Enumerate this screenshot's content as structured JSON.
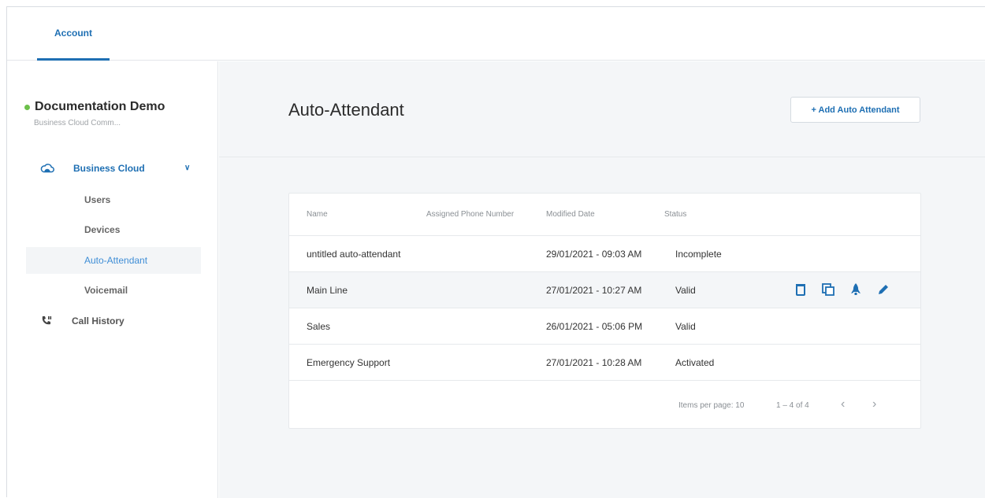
{
  "top_tabs": {
    "account": "Account"
  },
  "sidebar": {
    "account_name": "Documentation Demo",
    "account_sub": "Business Cloud Comm...",
    "group_label": "Business Cloud",
    "items": [
      {
        "label": "Users"
      },
      {
        "label": "Devices"
      },
      {
        "label": "Auto-Attendant"
      },
      {
        "label": "Voicemail"
      }
    ],
    "call_history": "Call History"
  },
  "main": {
    "title": "Auto-Attendant",
    "add_button": "+ Add Auto Attendant"
  },
  "table": {
    "columns": [
      "Name",
      "Assigned Phone Number",
      "Modified Date",
      "Status"
    ],
    "rows": [
      {
        "name": "untitled auto-attendant",
        "phone": "",
        "modified": "29/01/2021 - 09:03 AM",
        "status": "Incomplete"
      },
      {
        "name": "Main Line",
        "phone": "",
        "modified": "27/01/2021 - 10:27 AM",
        "status": "Valid"
      },
      {
        "name": "Sales",
        "phone": "",
        "modified": "26/01/2021 - 05:06 PM",
        "status": "Valid"
      },
      {
        "name": "Emergency Support",
        "phone": "",
        "modified": "27/01/2021 - 10:28 AM",
        "status": "Activated"
      }
    ],
    "row_actions": [
      "trash-icon",
      "copy-icon",
      "rocket-icon",
      "pencil-icon"
    ]
  },
  "pagination": {
    "items_per_page": "Items per page: 10",
    "range": "1 – 4 of 4",
    "prev": "‹",
    "next": "›"
  },
  "colors": {
    "accent": "#1e6fb3",
    "status_dot": "#6cc04a",
    "background": "#f4f6f8"
  }
}
